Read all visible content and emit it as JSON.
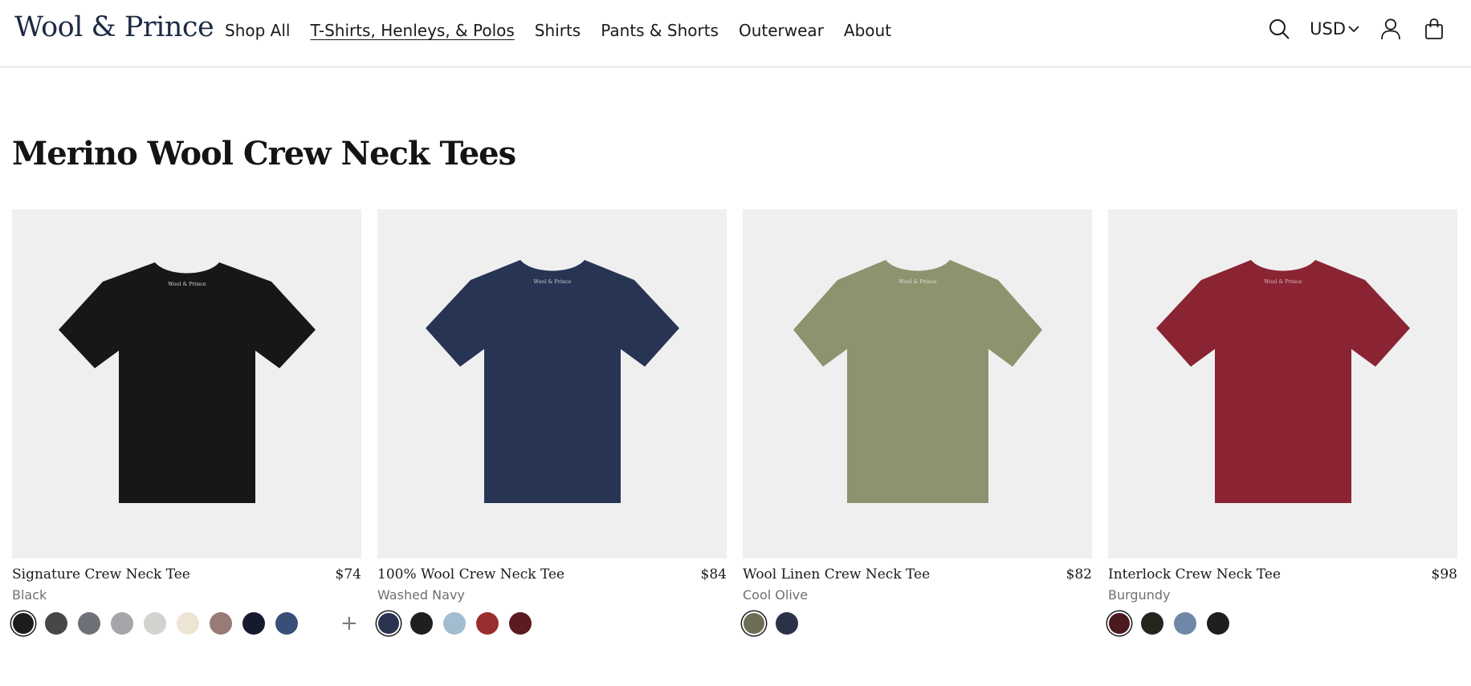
{
  "header": {
    "logo": "Wool & Prince",
    "nav": [
      {
        "label": "Shop All",
        "active": false
      },
      {
        "label": "T-Shirts, Henleys, & Polos",
        "active": true
      },
      {
        "label": "Shirts",
        "active": false
      },
      {
        "label": "Pants & Shorts",
        "active": false
      },
      {
        "label": "Outerwear",
        "active": false
      },
      {
        "label": "About",
        "active": false
      }
    ],
    "currency": "USD",
    "icons": [
      "search-icon",
      "chevron-down-icon",
      "account-icon",
      "shopping-bag-icon"
    ]
  },
  "page": {
    "title": "Merino Wool Crew Neck Tees"
  },
  "products": [
    {
      "name": "Signature Crew Neck Tee",
      "price": "$74",
      "color": "Black",
      "shirt_color": "#17171a",
      "swatches": [
        "#1c1c1e",
        "#47474a",
        "#6f7179",
        "#a6a6aa",
        "#d2d2ce",
        "#ede4d4",
        "#9a7a76",
        "#161a2e",
        "#3a4f78"
      ],
      "selected": 0,
      "more": "+"
    },
    {
      "name": "100% Wool Crew Neck Tee",
      "price": "$84",
      "color": "Washed Navy",
      "shirt_color": "#283454",
      "swatches": [
        "#2a3350",
        "#1f1f21",
        "#a2bcd0",
        "#9a2e2e",
        "#5b1b20"
      ],
      "selected": 0,
      "more": ""
    },
    {
      "name": "Wool Linen Crew Neck Tee",
      "price": "$82",
      "color": "Cool Olive",
      "shirt_color": "#8e926e",
      "swatches": [
        "#6e6e56",
        "#2b3146"
      ],
      "selected": 0,
      "more": ""
    },
    {
      "name": "Interlock Crew Neck Tee",
      "price": "$98",
      "color": "Burgundy",
      "shirt_color": "#8a2433",
      "swatches": [
        "#4a1a1e",
        "#24251e",
        "#7187a8",
        "#1f1f21"
      ],
      "selected": 0,
      "more": ""
    }
  ]
}
